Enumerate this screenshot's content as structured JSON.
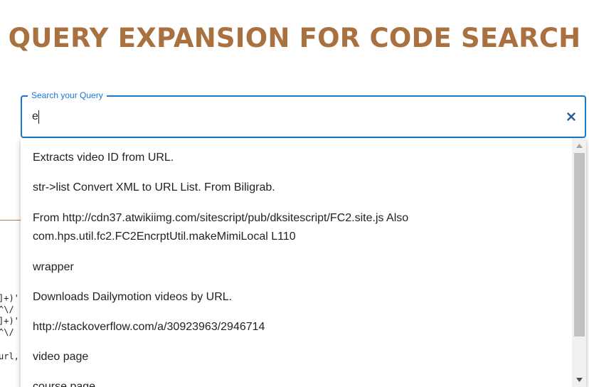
{
  "header": {
    "title": "QUERY EXPANSION FOR CODE SEARCH"
  },
  "background": {
    "code_lines": [
      "]+)'",
      "^\\/",
      "]+)'",
      "^\\/"
    ],
    "code_tail": "url,"
  },
  "search": {
    "label": "Search your Query",
    "value": "e",
    "clear_icon": "close-icon"
  },
  "suggestions": [
    {
      "text": "Extracts video ID from URL."
    },
    {
      "text": "str->list Convert XML to URL List. From Biligrab."
    },
    {
      "text": "From http://cdn37.atwikiimg.com/sitescript/pub/dksitescript/FC2.site.js Also com.hps.util.fc2.FC2EncrptUtil.makeMimiLocal L110"
    },
    {
      "text": "wrapper"
    },
    {
      "text": "Downloads Dailymotion videos by URL."
    },
    {
      "text": "http://stackoverflow.com/a/30923963/2946714"
    },
    {
      "text": "video page"
    },
    {
      "text": "course page"
    }
  ],
  "colors": {
    "title": "#a9713f",
    "accent": "#1976d2",
    "clear_icon": "#2b5c9a"
  }
}
